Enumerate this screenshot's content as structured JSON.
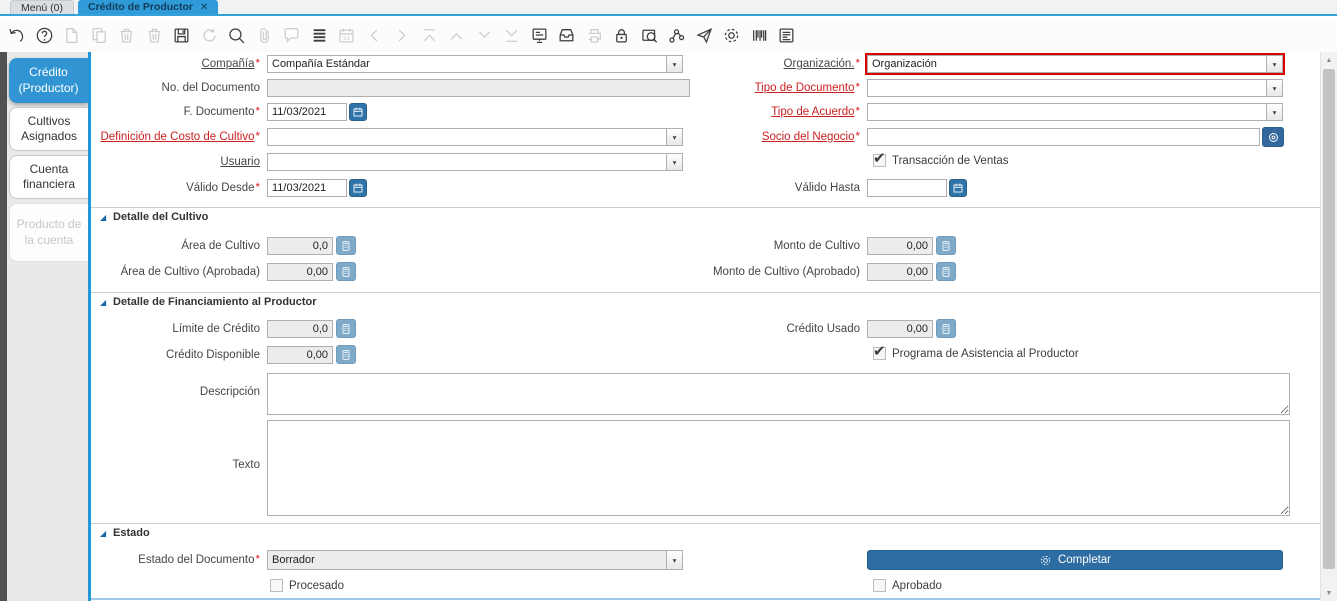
{
  "window_tabs": {
    "menu": "Menú (0)",
    "active": "Crédito de Productor",
    "close_glyph": "✕"
  },
  "toolbar": {
    "icons": [
      {
        "name": "undo",
        "enabled": true
      },
      {
        "name": "help",
        "enabled": true
      },
      {
        "name": "new-record",
        "enabled": false
      },
      {
        "name": "copy-record",
        "enabled": false
      },
      {
        "name": "delete-record",
        "enabled": false
      },
      {
        "name": "delete-selection",
        "enabled": false
      },
      {
        "name": "save",
        "enabled": true
      },
      {
        "name": "refresh",
        "enabled": false
      },
      {
        "name": "find",
        "enabled": true
      },
      {
        "name": "attachment",
        "enabled": false
      },
      {
        "name": "chat",
        "enabled": false
      },
      {
        "name": "toggle-grid",
        "enabled": true
      },
      {
        "name": "calendar",
        "enabled": false
      },
      {
        "name": "parent-record",
        "enabled": false
      },
      {
        "name": "detail-record",
        "enabled": false
      },
      {
        "name": "first-record",
        "enabled": false
      },
      {
        "name": "previous-record",
        "enabled": false
      },
      {
        "name": "next-record",
        "enabled": false
      },
      {
        "name": "last-record",
        "enabled": false
      },
      {
        "name": "report",
        "enabled": true
      },
      {
        "name": "archive",
        "enabled": true
      },
      {
        "name": "print",
        "enabled": false
      },
      {
        "name": "lock",
        "enabled": true
      },
      {
        "name": "zoom-across",
        "enabled": true
      },
      {
        "name": "workflow",
        "enabled": true
      },
      {
        "name": "send-mail",
        "enabled": true
      },
      {
        "name": "process",
        "enabled": true
      },
      {
        "name": "export",
        "enabled": true
      },
      {
        "name": "report-window",
        "enabled": true
      }
    ]
  },
  "sidebar": {
    "tabs": [
      {
        "label": "Crédito (Productor)",
        "state": "active"
      },
      {
        "label": "Cultivos Asignados",
        "state": "normal"
      },
      {
        "label": "Cuenta financiera",
        "state": "normal"
      },
      {
        "label": "Producto de la cuenta",
        "state": "disabled"
      }
    ]
  },
  "icons": {
    "dropdown": "▾",
    "check": "✔",
    "scroll_up": "▲",
    "scroll_down": "▼",
    "section_arrow": "◢"
  },
  "form": {
    "required_marker": "*",
    "compania": {
      "label": "Compañía",
      "value": "Compañía Estándar",
      "required": true
    },
    "organizacion": {
      "label": "Organización.",
      "value": "Organización",
      "required": true,
      "highlighted": true
    },
    "no_documento": {
      "label": "No. del Documento",
      "value": "",
      "readonly": true
    },
    "tipo_documento": {
      "label": "Tipo de Documento",
      "value": "",
      "required": true
    },
    "f_documento": {
      "label": "F. Documento",
      "value": "11/03/2021",
      "required": true
    },
    "tipo_acuerdo": {
      "label": "Tipo de Acuerdo",
      "value": "",
      "required": true
    },
    "definicion_costo": {
      "label": "Definición de Costo de Cultivo",
      "value": "",
      "required": true
    },
    "socio_negocio": {
      "label": "Socio del Negocio",
      "value": "",
      "required": true
    },
    "usuario": {
      "label": "Usuario",
      "value": ""
    },
    "transaccion_ventas": {
      "label": "Transacción de Ventas",
      "checked": true
    },
    "valido_desde": {
      "label": "Válido Desde",
      "value": "11/03/2021",
      "required": true
    },
    "valido_hasta": {
      "label": "Válido Hasta",
      "value": ""
    }
  },
  "section_cultivo": {
    "title": "Detalle del Cultivo",
    "area": {
      "label": "Área de Cultivo",
      "value": "0,0"
    },
    "monto": {
      "label": "Monto de Cultivo",
      "value": "0,00"
    },
    "area_aprobada": {
      "label": "Área de Cultivo (Aprobada)",
      "value": "0,00"
    },
    "monto_aprobado": {
      "label": "Monto de Cultivo (Aprobado)",
      "value": "0,00"
    }
  },
  "section_financiamiento": {
    "title": "Detalle de Financiamiento al Productor",
    "limite": {
      "label": "Límite de Crédito",
      "value": "0,0"
    },
    "credito_usado": {
      "label": "Crédito Usado",
      "value": "0,00"
    },
    "credito_disponible": {
      "label": "Crédito Disponible",
      "value": "0,00"
    },
    "programa": {
      "label": "Programa de Asistencia al Productor",
      "checked": true
    },
    "descripcion": {
      "label": "Descripción",
      "value": ""
    },
    "texto": {
      "label": "Texto",
      "value": ""
    }
  },
  "section_estado": {
    "title": "Estado",
    "estado_documento": {
      "label": "Estado del Documento",
      "value": "Borrador",
      "required": true
    },
    "completar_button": "Completar",
    "procesado": {
      "label": "Procesado",
      "checked": false
    },
    "aprobado": {
      "label": "Aprobado",
      "checked": false
    }
  },
  "colors": {
    "accent_blue": "#2f9bd8",
    "sidebar_divider": "#2196d9",
    "active_tab": "#3095d2",
    "highlight_border": "#de0000",
    "required_red": "#cc2020",
    "button_blue": "#2d6da3",
    "calendar_button": "#2f74a8",
    "calc_button": "#7ea9c8",
    "socio_button": "#33689c"
  }
}
